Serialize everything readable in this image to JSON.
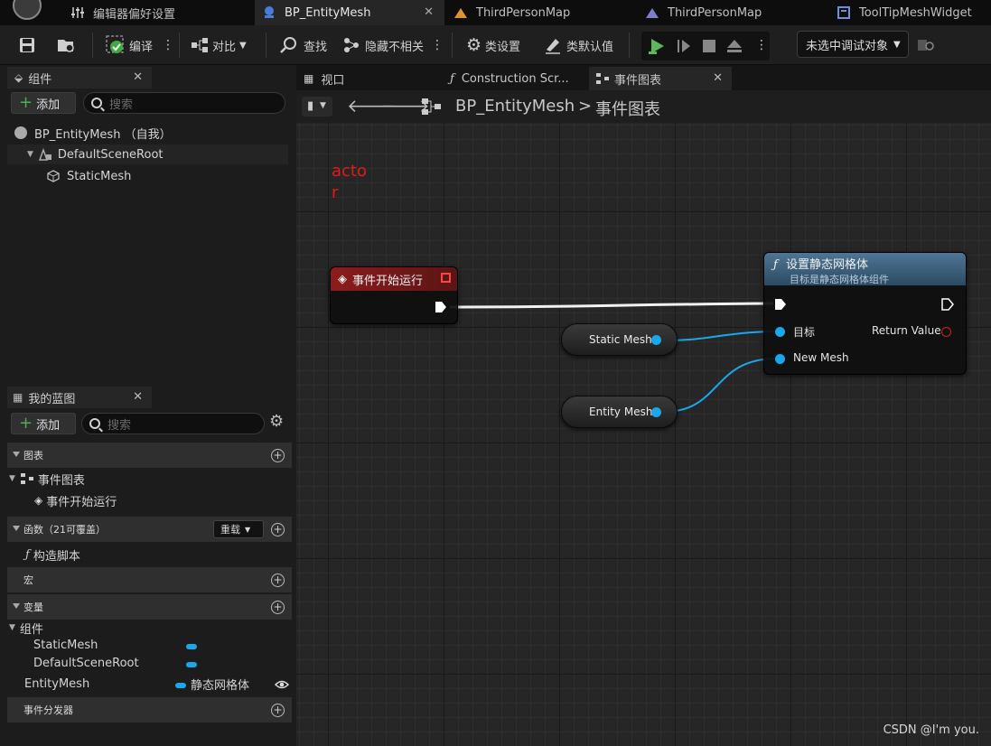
{
  "tabs": [
    {
      "label": "编辑器偏好设置",
      "icon": "sliders-icon",
      "active": false
    },
    {
      "label": "BP_EntityMesh",
      "icon": "blueprint-icon",
      "active": true
    },
    {
      "label": "ThirdPersonMap",
      "icon": "level-icon",
      "active": false
    },
    {
      "label": "ThirdPersonMap",
      "icon": "level-icon",
      "active": false
    },
    {
      "label": "ToolTipMeshWidget",
      "icon": "widget-icon",
      "active": false
    }
  ],
  "toolbar": {
    "compile": "编译",
    "diff": "对比",
    "find": "查找",
    "hide_unrelated": "隐藏不相关",
    "class_settings": "类设置",
    "class_defaults": "类默认值",
    "debug_object": "未选中调试对象"
  },
  "components_panel": {
    "title": "组件",
    "add_label": "添加",
    "search_placeholder": "搜索",
    "tree": [
      {
        "label": "BP_EntityMesh （自我）"
      },
      {
        "label": "DefaultSceneRoot"
      },
      {
        "label": "StaticMesh"
      }
    ]
  },
  "my_blueprint": {
    "title": "我的蓝图",
    "add_label": "添加",
    "search_placeholder": "搜索",
    "sections": {
      "graphs": "图表",
      "event_graph": "事件图表",
      "begin_play": "事件开始运行",
      "functions": "函数（21可覆盖）",
      "override": "重载",
      "construction": "构造脚本",
      "macros": "宏",
      "variables": "变量",
      "components": "组件",
      "var_static_mesh": "StaticMesh",
      "var_default_root": "DefaultSceneRoot",
      "var_entity_mesh": "EntityMesh",
      "var_entity_type": "静态网格体",
      "dispatchers": "事件分发器"
    }
  },
  "graph": {
    "tabs": [
      "视口",
      "Construction Scr...",
      "事件图表"
    ],
    "breadcrumb_root": "BP_EntityMesh",
    "breadcrumb_sep": ">",
    "breadcrumb_leaf": "事件图表",
    "comment": "actor",
    "event_node": {
      "title": "事件开始运行"
    },
    "set_node": {
      "title": "设置静态网格体",
      "subtitle": "目标是静态网格体组件",
      "pin_target": "目标",
      "pin_new_mesh": "New Mesh",
      "pin_return": "Return Value"
    },
    "var_static_mesh": "Static Mesh",
    "var_entity_mesh": "Entity Mesh"
  },
  "watermark": "CSDN @I'm you.",
  "colors": {
    "accent_blue": "#1aa7ec",
    "event_header": "#8c1c1c",
    "function_header": "#3d5e78",
    "comment_red": "#e01b1b",
    "play_green": "#5cb85c"
  }
}
